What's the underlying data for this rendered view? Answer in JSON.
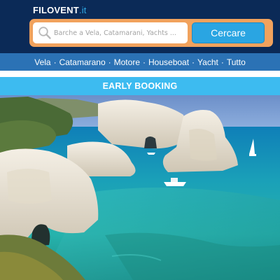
{
  "header": {
    "logo_main": "FILOVENT",
    "logo_tld": ".it",
    "logo_color": "#ffffff",
    "tld_color": "#2fa9e6",
    "background": "#0b2a57"
  },
  "search": {
    "placeholder": "Barche a Vela, Catamarani, Yachts ...",
    "button_label": "Cercare",
    "frame_color": "#f1a25d",
    "button_color": "#2aa5e2",
    "icon": "search-icon"
  },
  "nav": {
    "items": [
      {
        "label": "Vela"
      },
      {
        "label": "Catamarano"
      },
      {
        "label": "Motore"
      },
      {
        "label": "Houseboat"
      },
      {
        "label": "Yacht"
      },
      {
        "label": "Tutto"
      }
    ],
    "separator": "·",
    "background": "#2b72b5"
  },
  "banner": {
    "label": "EARLY BOOKING",
    "background": "#3dbbf0"
  },
  "hero": {
    "subject": "coastal bay photo"
  }
}
